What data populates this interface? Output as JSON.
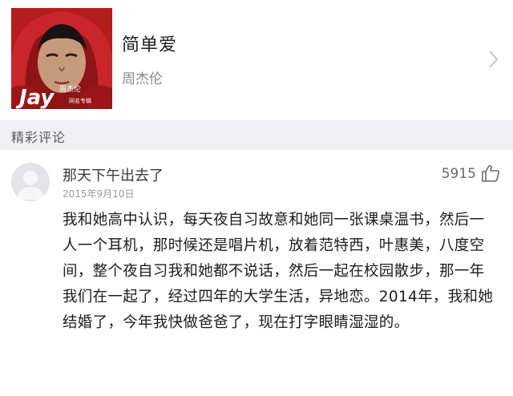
{
  "song": {
    "title": "简单爱",
    "artist": "周杰伦",
    "album_art_text": "Jay 周杰伦 同名专辑"
  },
  "section": {
    "title": "精彩评论"
  },
  "comment": {
    "username": "那天下午出去了",
    "date": "2015年9月10日",
    "likes": "5915",
    "body": "我和她高中认识，每天夜自习故意和她同一张课桌温书，然后一人一个耳机，那时候还是唱片机，放着范特西，叶惠美，八度空间，整个夜自习我和她都不说话，然后一起在校园散步，那一年我们在一起了，经过四年的大学生活，异地恋。2014年，我和她结婚了，今年我快做爸爸了，现在打字眼睛湿湿的。"
  },
  "icons": {
    "chevron": "chevron-right-icon",
    "like": "thumbs-up-icon",
    "avatar": "default-avatar-icon"
  },
  "colors": {
    "section_bg": "#f0f0f2",
    "album_red": "#b41c1e",
    "muted_text": "#8a8a8a"
  }
}
